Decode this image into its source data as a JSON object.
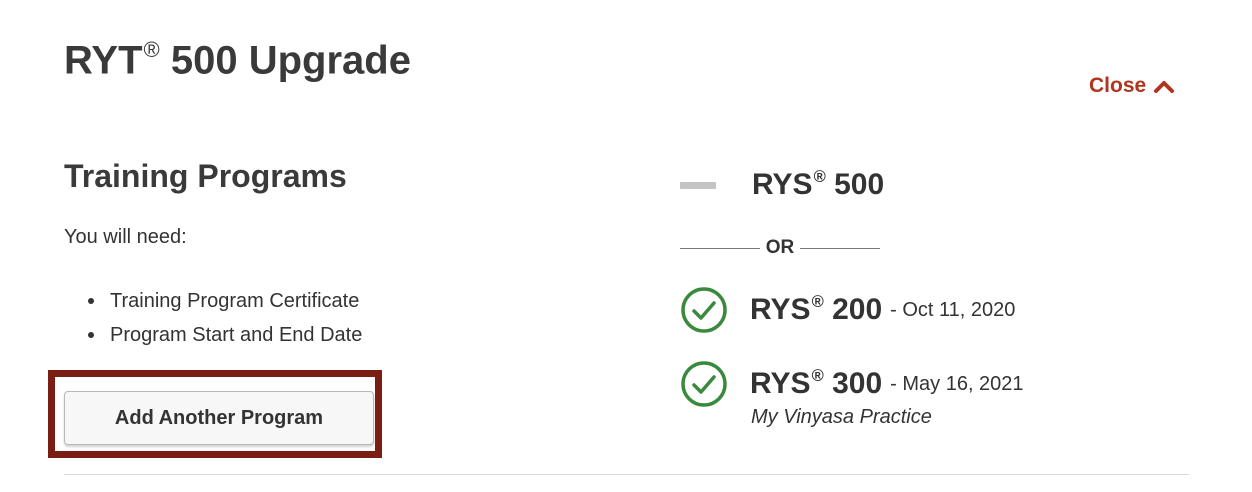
{
  "header": {
    "title_prefix": "RYT",
    "title_reg": "®",
    "title_suffix": " 500 Upgrade",
    "close_label": "Close"
  },
  "training": {
    "section_title": "Training Programs",
    "need_label": "You will need:",
    "requirements": [
      "Training Program Certificate",
      "Program Start and End Date"
    ],
    "add_button_label": "Add Another Program"
  },
  "programs": {
    "rys500": {
      "name_prefix": "RYS",
      "reg": "®",
      "name_suffix": " 500",
      "status_icon": "dash-icon"
    },
    "or_label": "OR",
    "rys200": {
      "name_prefix": "RYS",
      "reg": "®",
      "name_suffix": " 200",
      "date": "- Oct 11, 2020",
      "status_icon": "check-circle-icon"
    },
    "rys300": {
      "name_prefix": "RYS",
      "reg": "®",
      "name_suffix": " 300",
      "date": "- May 16, 2021",
      "school": "My Vinyasa Practice",
      "status_icon": "check-circle-icon"
    }
  },
  "colors": {
    "accent_red": "#b0351f",
    "highlight_border": "#7a1e14",
    "check_green": "#3a8a3e",
    "dash_gray": "#c4c4c4"
  }
}
